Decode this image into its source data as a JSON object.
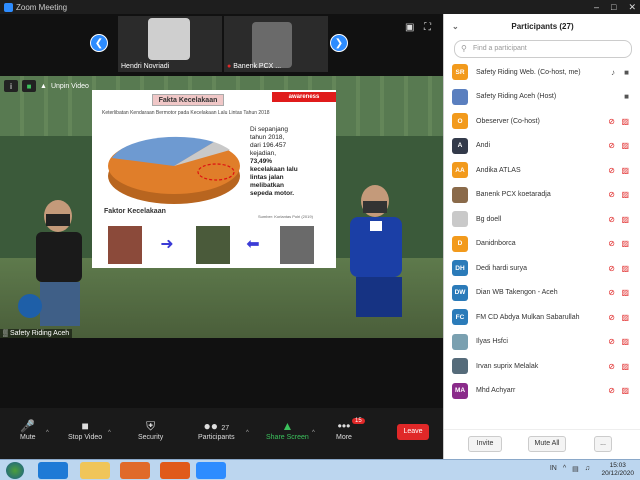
{
  "window": {
    "title": "Zoom Meeting"
  },
  "thumbs": [
    {
      "name": "Hendri Novriadi",
      "muted": false
    },
    {
      "name": "Banenk PCX ...",
      "muted": true
    }
  ],
  "main": {
    "unpin_label": "Unpin Video",
    "speaker_name": "Safety Riding Aceh",
    "slide": {
      "title": "Fakta Kecelakaan",
      "tag": "awareness",
      "subtitle": "Keterlibatan Kendaraan Bermotor pada Kecelakaan Lalu Lintas Tahun 2018",
      "stat_line1": "Di sepanjang",
      "stat_line2": "tahun 2018,",
      "stat_line3": "dari 196.457",
      "stat_line4": "kejadian,",
      "stat_line5": "73,49%",
      "stat_line6": "kecelakaan lalu",
      "stat_line7": "lintas jalan",
      "stat_line8": "melibatkan",
      "stat_line9": "sepeda motor.",
      "source": "Sumber: Korlantas Polri (2019)",
      "factor_title": "Faktor Kecelakaan"
    }
  },
  "toolbar": {
    "mute": "Mute",
    "stop_video": "Stop Video",
    "security": "Security",
    "participants": "Participants",
    "participants_count": "27",
    "share_screen": "Share Screen",
    "more": "More",
    "more_badge": "15",
    "leave": "Leave"
  },
  "panel": {
    "title": "Participants (27)",
    "search_placeholder": "Find a participant",
    "invite": "Invite",
    "mute_all": "Mute All",
    "more": "...",
    "participants": [
      {
        "initials": "SR",
        "color": "#f29a1c",
        "name": "Safety Riding Web. (Co-host, me)",
        "mic": "on",
        "cam": "on"
      },
      {
        "initials": "",
        "color": "#5a7fbf",
        "name": "Safety Riding Aceh (Host)",
        "mic": "none",
        "cam": "on"
      },
      {
        "initials": "O",
        "color": "#f29a1c",
        "name": "Obeserver (Co-host)",
        "mic": "off",
        "cam": "off"
      },
      {
        "initials": "A",
        "color": "#333a4a",
        "name": "Andi",
        "mic": "off",
        "cam": "off"
      },
      {
        "initials": "AA",
        "color": "#f29a1c",
        "name": "Andika ATLAS",
        "mic": "off",
        "cam": "off"
      },
      {
        "initials": "",
        "color": "#8a6a4a",
        "name": "Banenk PCX koetaradja",
        "mic": "off",
        "cam": "off"
      },
      {
        "initials": "",
        "color": "#c9c9c9",
        "name": "Bg doell",
        "mic": "off",
        "cam": "off"
      },
      {
        "initials": "D",
        "color": "#f29a1c",
        "name": "Danidnborca",
        "mic": "off",
        "cam": "off"
      },
      {
        "initials": "DH",
        "color": "#2b7bb9",
        "name": "Dedi hardi surya",
        "mic": "off",
        "cam": "off"
      },
      {
        "initials": "DW",
        "color": "#2b7bb9",
        "name": "Dian WB Takengon - Aceh",
        "mic": "off",
        "cam": "off"
      },
      {
        "initials": "FC",
        "color": "#2b7bb9",
        "name": "FM CD Abdya Mulkan Sabarullah",
        "mic": "off",
        "cam": "off"
      },
      {
        "initials": "",
        "color": "#7aa0b0",
        "name": "Ilyas Hsfci",
        "mic": "off",
        "cam": "off"
      },
      {
        "initials": "",
        "color": "#556b7a",
        "name": "Irvan suprix Melalak",
        "mic": "off",
        "cam": "off"
      },
      {
        "initials": "MA",
        "color": "#8a2b8a",
        "name": "Mhd Achyarr",
        "mic": "off",
        "cam": "off"
      }
    ]
  },
  "taskbar": {
    "lang": "IN",
    "time": "15:03",
    "date": "20/12/2020"
  }
}
